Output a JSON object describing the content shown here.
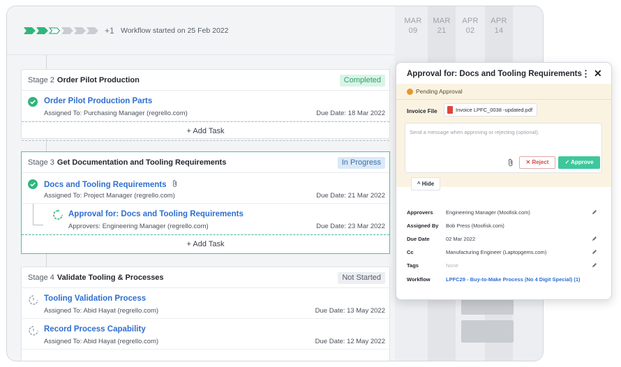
{
  "header": {
    "progress_more": "+1",
    "workflow_started": "Workflow started on 25 Feb 2022"
  },
  "calendar": [
    {
      "month": "MAR",
      "day": "09"
    },
    {
      "month": "MAR",
      "day": "21"
    },
    {
      "month": "APR",
      "day": "02"
    },
    {
      "month": "APR",
      "day": "14"
    }
  ],
  "stages": {
    "s2": {
      "num": "Stage 2",
      "title": "Order Pilot Production",
      "status": "Completed",
      "task": {
        "title": "Order Pilot Production Parts",
        "assigned_label": "Assigned To:",
        "assigned": "Purchasing Manager (regrello.com)",
        "due_label": "Due Date:",
        "due": "18 Mar 2022"
      },
      "add_task": "+ Add Task"
    },
    "s3": {
      "num": "Stage 3",
      "title": "Get Documentation and Tooling Requirements",
      "status": "In Progress",
      "task": {
        "title": "Docs and Tooling Requirements",
        "assigned_label": "Assigned To:",
        "assigned": "Project Manager (regrello.com)",
        "due_label": "Due Date:",
        "due": "21 Mar 2022"
      },
      "subtask": {
        "title": "Approval for: Docs and Tooling Requirements",
        "approvers_label": "Approvers:",
        "approvers": "Engineering Manager (regrello.com)",
        "due_label": "Due Date:",
        "due": "23 Mar 2022"
      },
      "add_task": "+ Add Task"
    },
    "s4": {
      "num": "Stage 4",
      "title": "Validate Tooling & Processes",
      "status": "Not Started",
      "tasks": [
        {
          "title": "Tooling Validation Process",
          "assigned_label": "Assigned To:",
          "assigned": "Abid Hayat (regrello.com)",
          "due_label": "Due Date:",
          "due": "13 May 2022"
        },
        {
          "title": "Record Process Capability",
          "assigned_label": "Assigned To:",
          "assigned": "Abid Hayat (regrello.com)",
          "due_label": "Due Date:",
          "due": "12 May 2022"
        }
      ]
    }
  },
  "panel": {
    "title": "Approval for: Docs and Tooling Requirements",
    "kebab": "⋮",
    "close": "✕",
    "pending": "Pending Approval",
    "invoice_label": "Invoice File",
    "invoice_file": "Invoice LPFC_0038 -updated.pdf",
    "message_placeholder": "Send a message when approving or rejecting (optional).",
    "reject": "✕  Reject",
    "approve": "✓  Approve",
    "hide": "^  Hide",
    "fields": {
      "approvers": {
        "label": "Approvers",
        "value": "Engineering Manager (Moofisk.com)"
      },
      "assigned_by": {
        "label": "Assigned By",
        "value": "Bob Press (Moofisk.com)"
      },
      "due_date": {
        "label": "Due Date",
        "value": "02 Mar 2022"
      },
      "cc": {
        "label": "Cc",
        "value": "Manufacturing Engineer (Laptopgems.com)"
      },
      "tags": {
        "label": "Tags",
        "value": "None"
      },
      "workflow": {
        "label": "Workflow",
        "value": "LPFC29 - Buy-to-Make Process (No 4 Digit Special) (1)"
      }
    }
  },
  "colors": {
    "accent_green": "#2fb67c",
    "link_blue": "#2e6fd0",
    "active_border": "#4cc3a2",
    "pending_orange": "#e7962b",
    "reject_red": "#d24b4b"
  }
}
